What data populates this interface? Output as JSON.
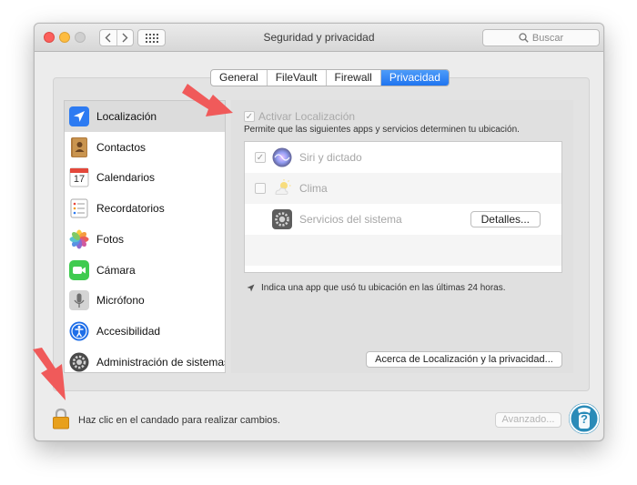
{
  "window": {
    "title": "Seguridad y privacidad",
    "search_placeholder": "Buscar"
  },
  "tabs": [
    {
      "label": "General",
      "active": false
    },
    {
      "label": "FileVault",
      "active": false
    },
    {
      "label": "Firewall",
      "active": false
    },
    {
      "label": "Privacidad",
      "active": true
    }
  ],
  "sidebar": {
    "items": [
      {
        "label": "Localización",
        "icon": "location-arrow-icon",
        "selected": true
      },
      {
        "label": "Contactos",
        "icon": "contacts-book-icon",
        "selected": false
      },
      {
        "label": "Calendarios",
        "icon": "calendar-icon",
        "selected": false
      },
      {
        "label": "Recordatorios",
        "icon": "reminders-icon",
        "selected": false
      },
      {
        "label": "Fotos",
        "icon": "photos-icon",
        "selected": false
      },
      {
        "label": "Cámara",
        "icon": "camera-icon",
        "selected": false
      },
      {
        "label": "Micrófono",
        "icon": "microphone-icon",
        "selected": false
      },
      {
        "label": "Accesibilidad",
        "icon": "accessibility-icon",
        "selected": false
      },
      {
        "label": "Administración de sistemas",
        "icon": "system-admin-icon",
        "selected": false
      }
    ]
  },
  "calendar_icon_day": "17",
  "location": {
    "enable_label": "Activar Localización",
    "enable_checked": true,
    "permit_text": "Permite que las siguientes apps y servicios determinen tu ubicación.",
    "apps": [
      {
        "name": "Siri y dictado",
        "checked": true,
        "icon": "siri-icon"
      },
      {
        "name": "Clima",
        "checked": false,
        "icon": "weather-icon"
      },
      {
        "name": "Servicios del sistema",
        "icon": "gear-icon"
      }
    ],
    "details_button": "Detalles...",
    "recent_note": "Indica una app que usó tu ubicación en las últimas 24 horas.",
    "about_button": "Acerca de Localización y la privacidad..."
  },
  "footer": {
    "lock_text": "Haz clic en el candado para realizar cambios.",
    "advanced_button": "Avanzado...",
    "help_glyph": "?"
  },
  "colors": {
    "accent_blue": "#1f74f0",
    "annotation_arrow": "#f05a5a",
    "lock_gold": "#e8a01c"
  }
}
